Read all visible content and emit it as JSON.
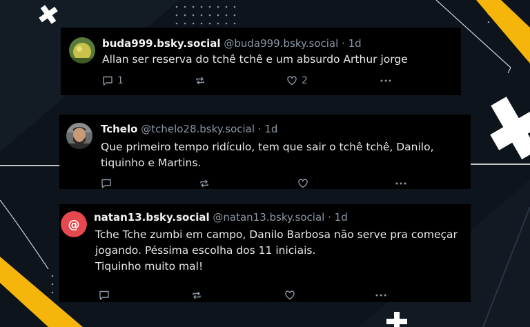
{
  "posts": [
    {
      "display_name": "buda999.bsky.social",
      "handle": "@buda999.bsky.social",
      "separator": "·",
      "time": "1d",
      "text_lines": [
        "Allan ser reserva do tchê tchê e um absurdo Arthur jorge"
      ],
      "replies": "1",
      "reposts": "",
      "likes": "2",
      "avatar": "green-ball-avatar"
    },
    {
      "display_name": "Tchelo",
      "handle": "@tchelo28.bsky.social",
      "separator": "·",
      "time": "1d",
      "text_lines": [
        "Que primeiro tempo ridículo, tem que sair o tchê tchê, Danilo,",
        "tiquinho e Martins."
      ],
      "replies": "",
      "reposts": "",
      "likes": "",
      "avatar": "bearded-man-avatar"
    },
    {
      "display_name": "natan13.bsky.social",
      "handle": "@natan13.bsky.social",
      "separator": "·",
      "time": "1d",
      "text_lines": [
        "Tche Tche zumbi em campo, Danilo Barbosa não serve pra começar",
        "jogando. Péssima escolha dos 11 iniciais.",
        "Tiquinho muito mal!"
      ],
      "replies": "",
      "reposts": "",
      "likes": "",
      "avatar": "at-sign-avatar"
    }
  ],
  "colors": {
    "background": "#0e141b",
    "card": "#000000",
    "accent_yellow": "#f5b50a",
    "text": "#e7e9ea",
    "muted": "#8b98a5",
    "avatar_red": "#e5484d"
  }
}
